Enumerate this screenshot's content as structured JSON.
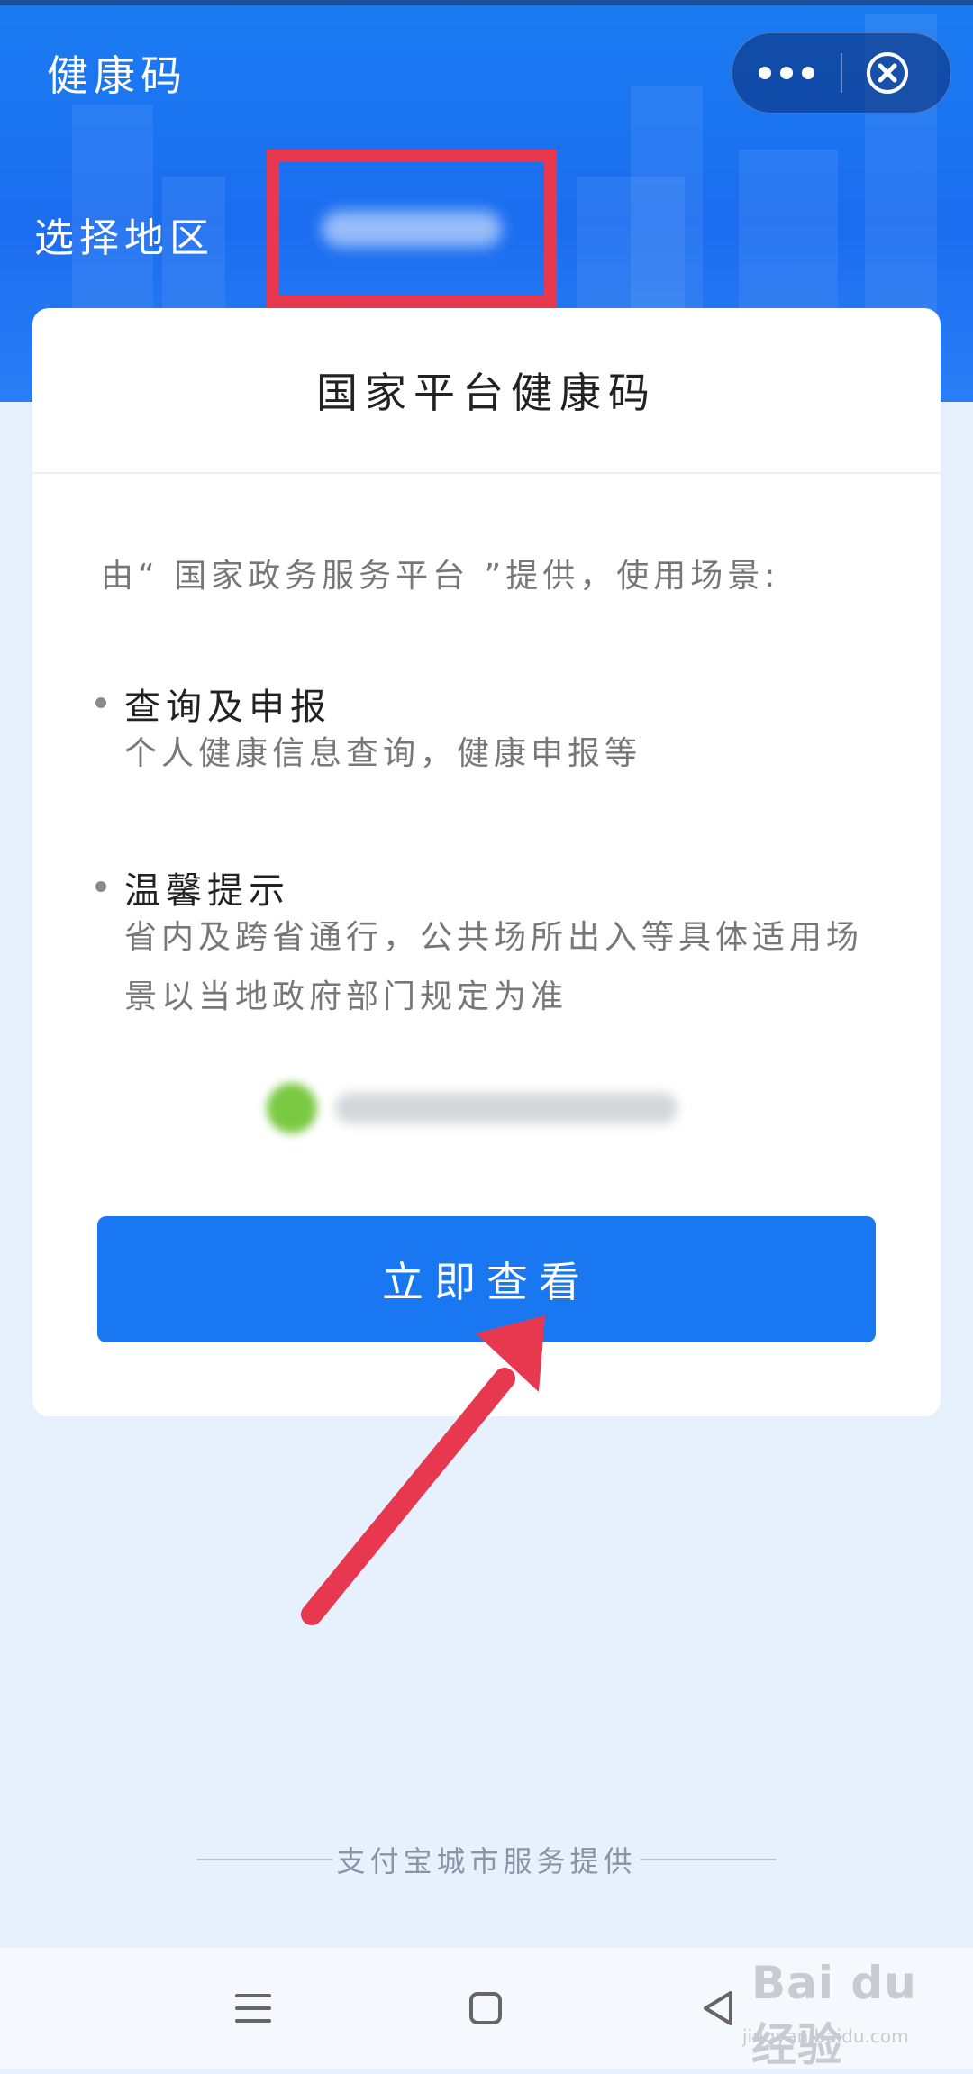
{
  "header": {
    "title": "健康码",
    "region_label": "选择地区",
    "more_icon": "more-dots-icon",
    "close_icon": "close-circle-icon"
  },
  "card": {
    "title": "国家平台健康码",
    "intro": "由“ 国家政务服务平台 ”提供，使用场景:",
    "sections": [
      {
        "heading": "查询及申报",
        "body": "个人健康信息查询，健康申报等"
      },
      {
        "heading": "温馨提示",
        "body": "省内及跨省通行，公共场所出入等具体适用场景以当地政府部门规定为准"
      }
    ],
    "cta_label": "立即查看"
  },
  "footer": {
    "provider_text": "支付宝城市服务提供"
  },
  "navbar": {
    "icons": [
      "menu-icon",
      "home-square-icon",
      "back-triangle-icon"
    ]
  },
  "watermark": {
    "logo": "Bai du 经验",
    "url": "jingyan.baidu.com"
  },
  "colors": {
    "header_blue": "#1b7cf2",
    "button_blue": "#1a77f2",
    "highlight_red": "#e8384f",
    "page_bg": "#e7f0fd"
  }
}
